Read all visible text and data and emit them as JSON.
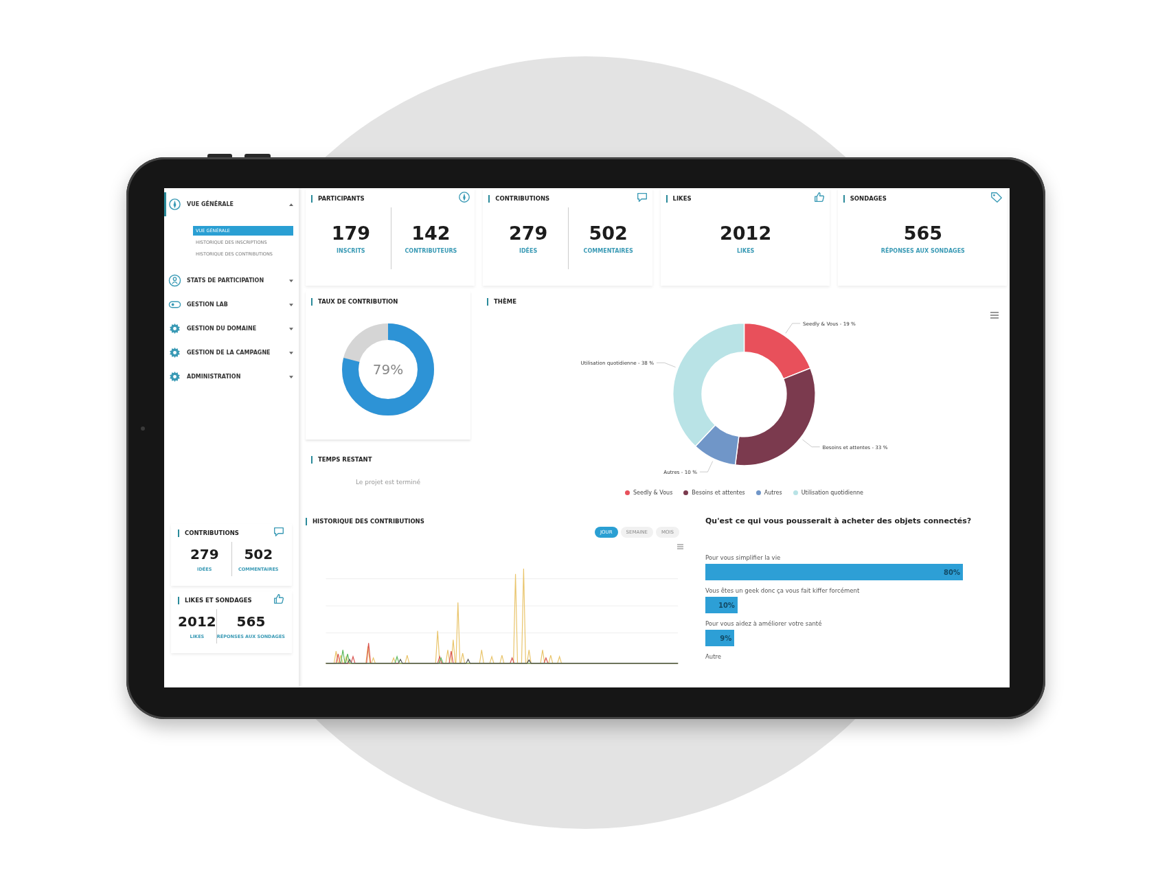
{
  "sidebar": {
    "items": [
      {
        "label": "VUE GÉNÉRALE",
        "kind": "compass",
        "expanded": true,
        "children": [
          {
            "label": "VUE GÉNÉRALE",
            "selected": true
          },
          {
            "label": "HISTORIQUE DES INSCRIPTIONS",
            "selected": false
          },
          {
            "label": "HISTORIQUE DES CONTRIBUTIONS",
            "selected": false
          }
        ]
      },
      {
        "label": "STATS DE PARTICIPATION",
        "kind": "person",
        "expanded": false
      },
      {
        "label": "GESTION LAB",
        "kind": "toggle",
        "expanded": false
      },
      {
        "label": "GESTION DU DOMAINE",
        "kind": "gear",
        "expanded": false
      },
      {
        "label": "GESTION DE LA CAMPAGNE",
        "kind": "gear",
        "expanded": false
      },
      {
        "label": "ADMINISTRATION",
        "kind": "gear",
        "expanded": false
      }
    ],
    "mini_cards": [
      {
        "title": "CONTRIBUTIONS",
        "kind": "bubble",
        "stats": [
          {
            "value": "279",
            "label": "IDÉES"
          },
          {
            "value": "502",
            "label": "COMMENTAIRES"
          }
        ]
      },
      {
        "title": "LIKES ET SONDAGES",
        "kind": "thumb",
        "stats": [
          {
            "value": "2012",
            "label": "LIKES"
          },
          {
            "value": "565",
            "label": "RÉPONSES AUX SONDAGES"
          }
        ]
      }
    ]
  },
  "stat_cards": [
    {
      "title": "PARTICIPANTS",
      "kind": "compass",
      "stats": [
        {
          "value": "179",
          "label": "INSCRITS"
        },
        {
          "value": "142",
          "label": "CONTRIBUTEURS"
        }
      ]
    },
    {
      "title": "CONTRIBUTIONS",
      "kind": "bubble",
      "stats": [
        {
          "value": "279",
          "label": "IDÉES"
        },
        {
          "value": "502",
          "label": "COMMENTAIRES"
        }
      ]
    },
    {
      "title": "LIKES",
      "kind": "thumb",
      "stats": [
        {
          "value": "2012",
          "label": "LIKES"
        }
      ]
    },
    {
      "title": "SONDAGES",
      "kind": "tag",
      "stats": [
        {
          "value": "565",
          "label": "RÉPONSES AUX SONDAGES"
        }
      ]
    }
  ],
  "contribution_rate": {
    "title": "TAUX DE CONTRIBUTION",
    "level": 0.79,
    "reading": "79%"
  },
  "time_left": {
    "title": "TEMPS RESTANT",
    "message": "Le projet est terminé"
  },
  "theme": {
    "title": "THÈME",
    "chart_data": {
      "type": "donut",
      "categories": [
        "Seedly & Vous",
        "Besoins et attentes",
        "Autres",
        "Utilisation quotidienne"
      ],
      "values": [
        19,
        33,
        10,
        38
      ],
      "annotations": [
        {
          "text": "Seedly & Vous - 19 %"
        },
        {
          "text": "Besoins et attentes - 33 %"
        },
        {
          "text": "Autres - 10 %"
        },
        {
          "text": "Utilisation quotidienne - 38 %"
        }
      ]
    },
    "legend": [
      {
        "color": "#e8505b"
      },
      {
        "color": "#7b3a4e"
      },
      {
        "color": "#7096c8"
      },
      {
        "color": "#b9e3e6"
      }
    ]
  },
  "history": {
    "title": "HISTORIQUE DES CONTRIBUTIONS",
    "periods": [
      {
        "label": "JOUR",
        "selected": true
      },
      {
        "label": "SEMAINE",
        "selected": false
      },
      {
        "label": "MOIS",
        "selected": false
      }
    ]
  },
  "survey": {
    "question": "Qu'est ce qui vous pousserait à acheter des objets connectés?",
    "answers": [
      {
        "label": "Pour vous simplifier la vie",
        "reading": "80%"
      },
      {
        "label": "Vous êtes un geek donc ça vous fait kiffer forcément",
        "reading": "10%"
      },
      {
        "label": "Pour vous aidez à améliorer votre santé",
        "reading": "9%"
      },
      {
        "label": "Autre"
      }
    ]
  }
}
